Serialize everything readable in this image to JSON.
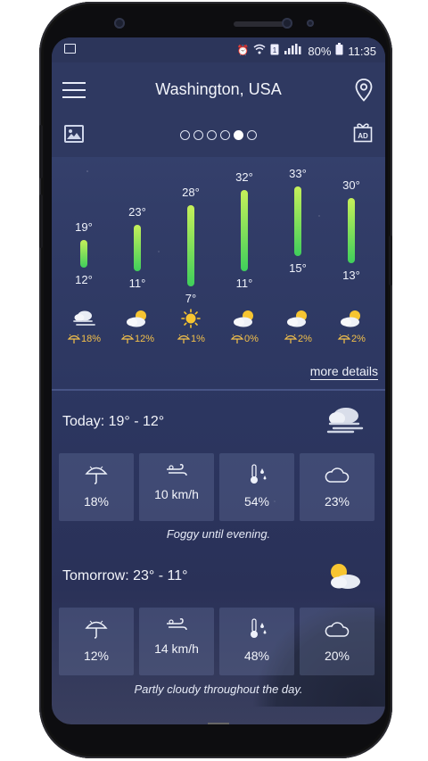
{
  "status_bar": {
    "battery": "80%",
    "time": "11:35"
  },
  "header": {
    "location": "Washington, USA",
    "pages": [
      false,
      false,
      false,
      false,
      true,
      false
    ]
  },
  "forecast": [
    {
      "high": "19°",
      "low": "12°",
      "precip": "18%",
      "icon": "fog-icon"
    },
    {
      "high": "23°",
      "low": "11°",
      "precip": "12%",
      "icon": "partly-cloudy-icon"
    },
    {
      "high": "28°",
      "low": "7°",
      "precip": "1%",
      "icon": "sun-icon"
    },
    {
      "high": "32°",
      "low": "11°",
      "precip": "0%",
      "icon": "partly-cloudy-icon"
    },
    {
      "high": "33°",
      "low": "15°",
      "precip": "2%",
      "icon": "partly-cloudy-icon"
    },
    {
      "high": "30°",
      "low": "13°",
      "precip": "2%",
      "icon": "partly-cloudy-icon"
    }
  ],
  "more_details": "more details",
  "today": {
    "title": "Today:  19° - 12°",
    "icon": "fog-cloud-icon",
    "precip": "18%",
    "wind": "10 km/h",
    "humidity": "54%",
    "cloud": "23%",
    "summary": "Foggy until evening."
  },
  "tomorrow": {
    "title": "Tomorrow:  23° - 11°",
    "icon": "partly-cloudy-icon",
    "precip": "12%",
    "wind": "14 km/h",
    "humidity": "48%",
    "cloud": "20%",
    "summary": "Partly cloudy throughout the day."
  },
  "colors": {
    "bar_top": "#c6f05a",
    "bar_bottom": "#3fcf5b",
    "precip_text": "#f3c04a",
    "sun": "#f7c531"
  }
}
